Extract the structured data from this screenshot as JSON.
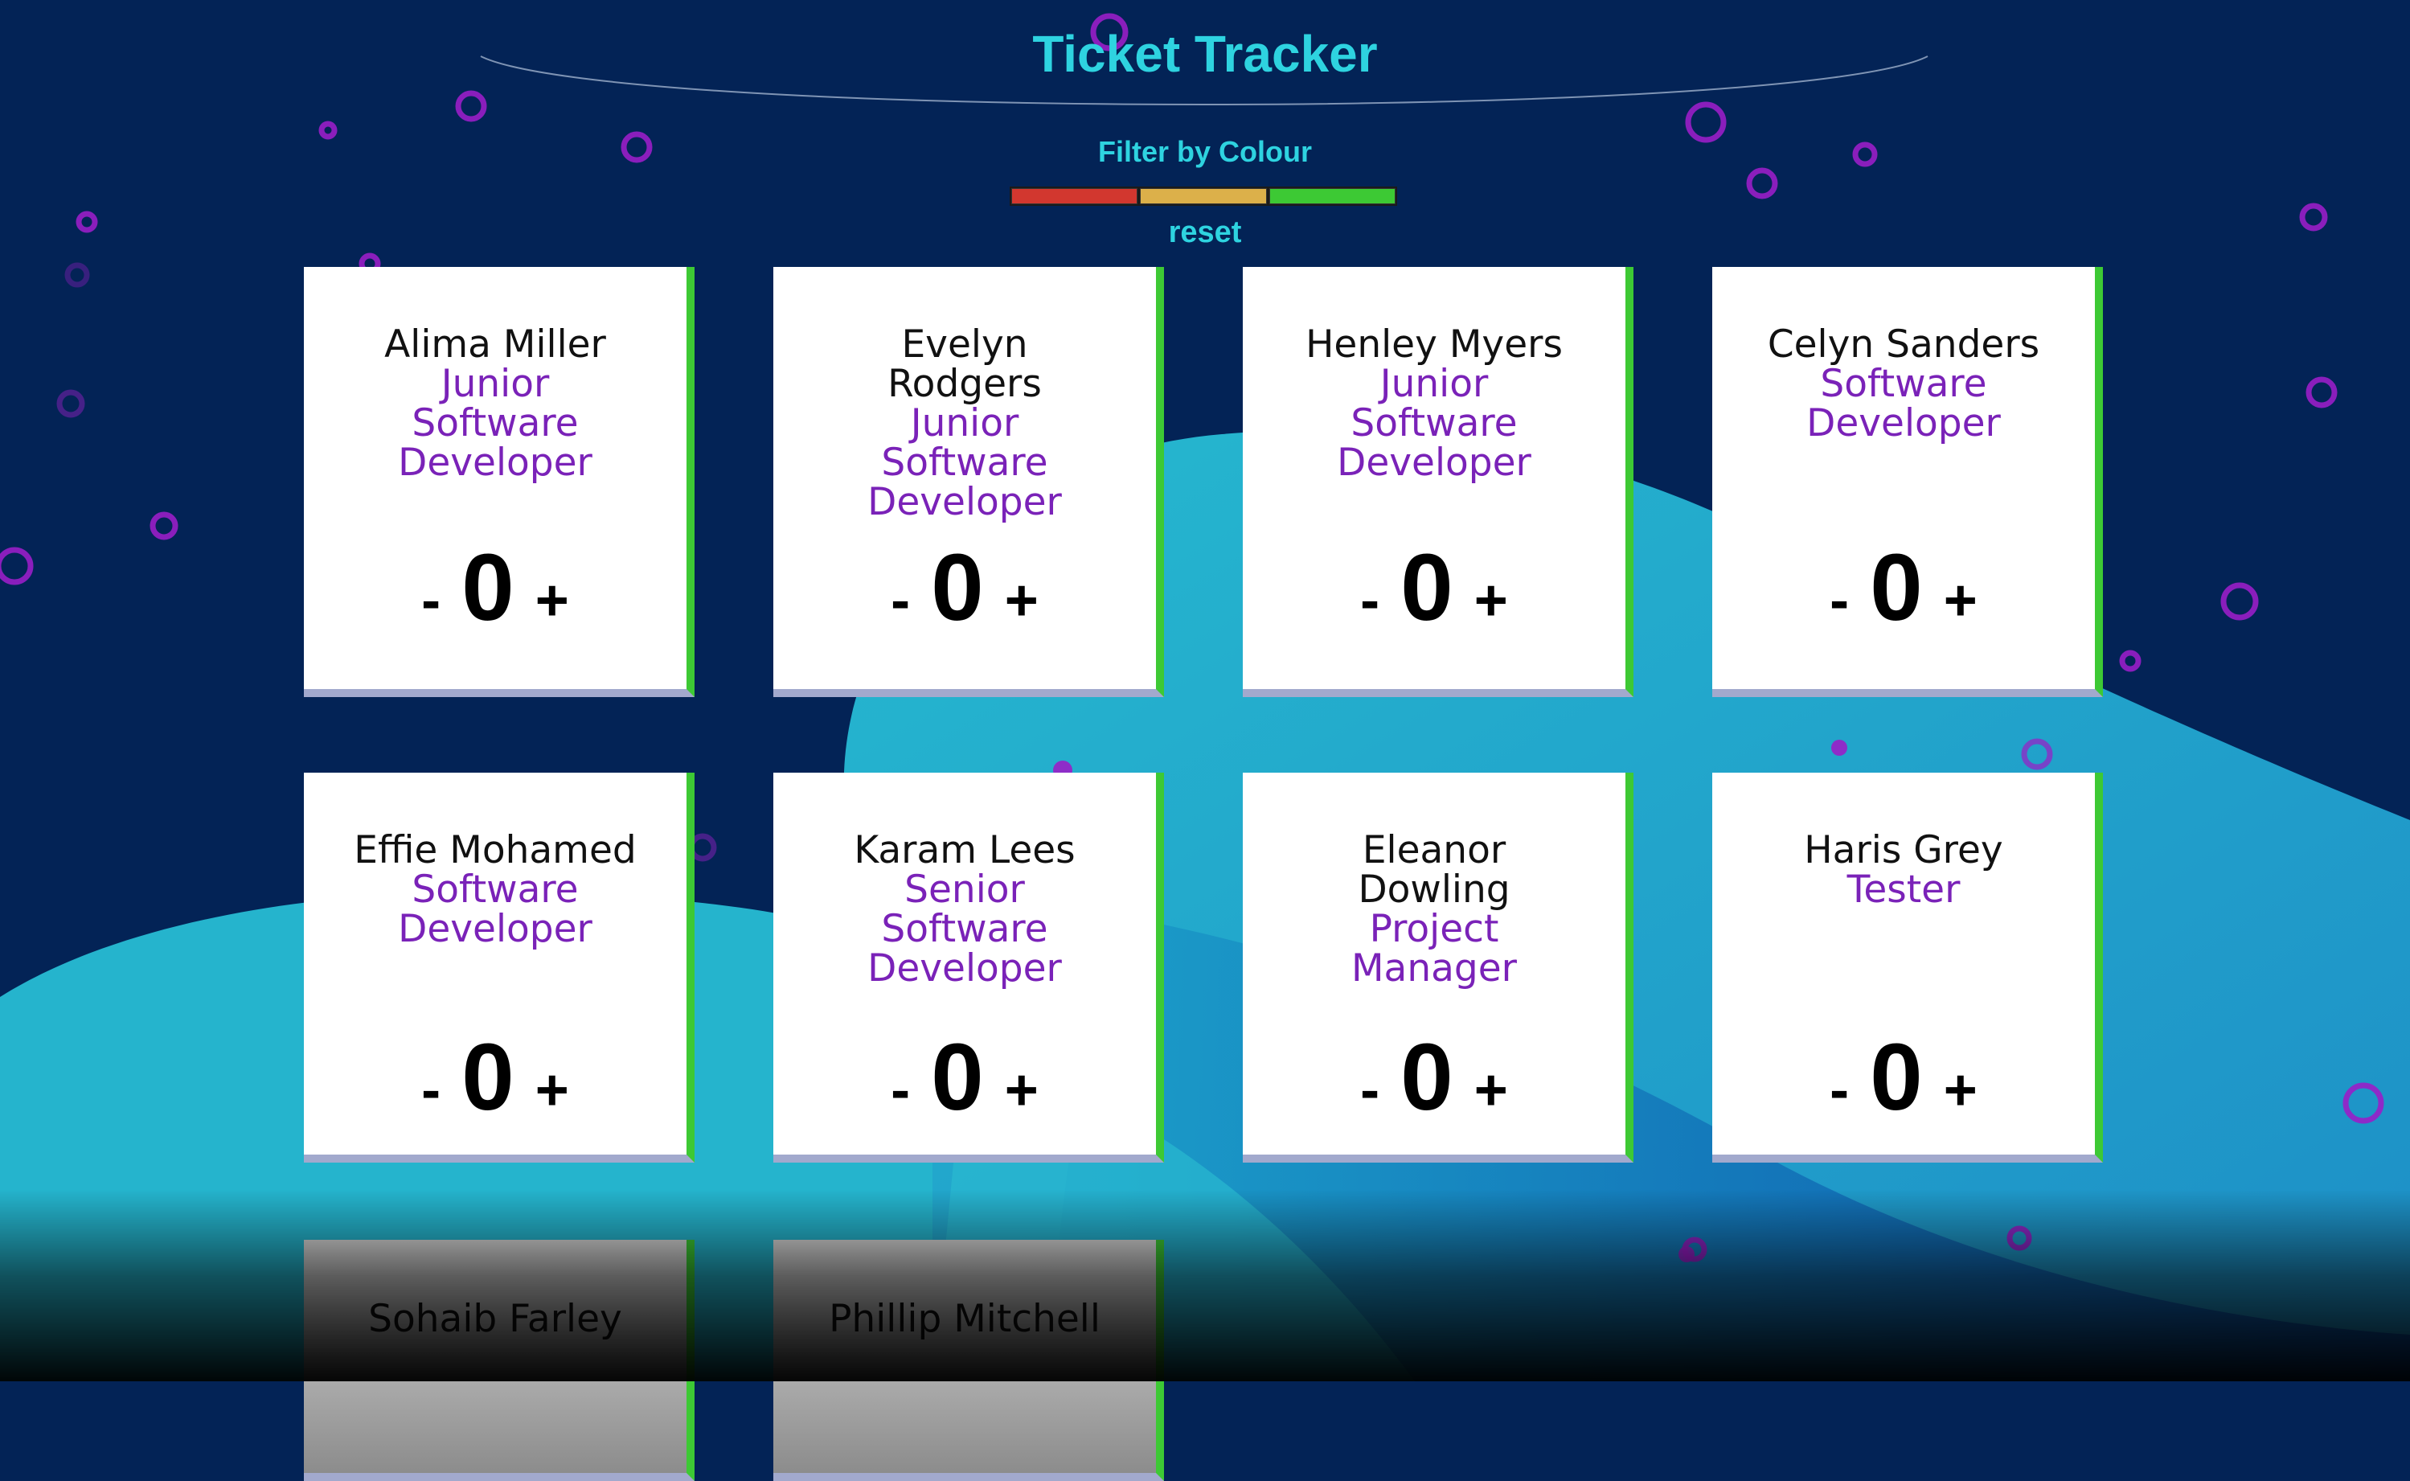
{
  "app": {
    "title": "Ticket Tracker",
    "filter_label": "Filter by Colour",
    "reset_label": "reset",
    "filter_colors": [
      {
        "name": "red",
        "hex": "#d2372f"
      },
      {
        "name": "amber",
        "hex": "#dcb04a"
      },
      {
        "name": "green",
        "hex": "#3dc934"
      }
    ]
  },
  "colors": {
    "background": "#032356",
    "accent": "#2ed3e0",
    "role_text": "#7a22b8",
    "card_border": "#3dc934"
  },
  "employees": [
    {
      "name": "Alima Miller",
      "role": "Junior Software Developer",
      "tickets": "0",
      "dec": "-",
      "inc": "+"
    },
    {
      "name": "Evelyn Rodgers",
      "role": "Junior Software Developer",
      "tickets": "0",
      "dec": "-",
      "inc": "+"
    },
    {
      "name": "Henley Myers",
      "role": "Junior Software Developer",
      "tickets": "0",
      "dec": "-",
      "inc": "+"
    },
    {
      "name": "Celyn Sanders",
      "role": "Software Developer",
      "tickets": "0",
      "dec": "-",
      "inc": "+"
    },
    {
      "name": "Effie Mohamed",
      "role": "Software Developer",
      "tickets": "0",
      "dec": "-",
      "inc": "+"
    },
    {
      "name": "Karam Lees",
      "role": "Senior Software Developer",
      "tickets": "0",
      "dec": "-",
      "inc": "+"
    },
    {
      "name": "Eleanor Dowling",
      "role": "Project Manager",
      "tickets": "0",
      "dec": "-",
      "inc": "+"
    },
    {
      "name": "Haris Grey",
      "role": "Tester",
      "tickets": "0",
      "dec": "-",
      "inc": "+"
    },
    {
      "name": "Sohaib Farley"
    },
    {
      "name": "Phillip Mitchell"
    }
  ]
}
